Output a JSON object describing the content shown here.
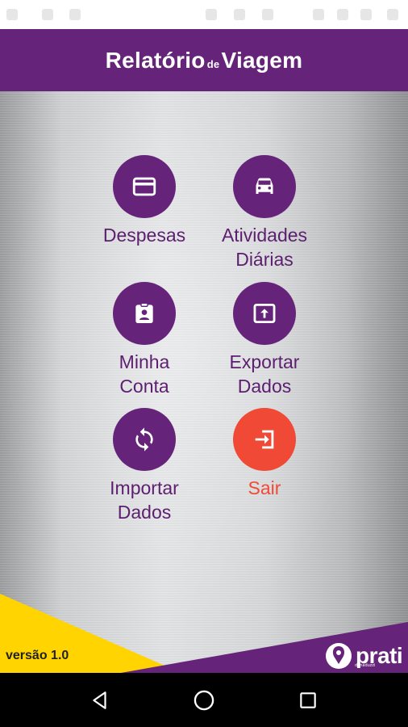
{
  "app": {
    "title_left": "Relatório",
    "title_connector": "de",
    "title_right": "Viagem"
  },
  "menu": {
    "despesas": {
      "label": "Despesas",
      "icon": "credit-card-icon"
    },
    "atividades": {
      "label": "Atividades\nDiárias",
      "icon": "car-icon"
    },
    "minha_conta": {
      "label": "Minha\nConta",
      "icon": "id-badge-icon"
    },
    "exportar": {
      "label": "Exportar\nDados",
      "icon": "upload-icon"
    },
    "importar": {
      "label": "Importar\nDados",
      "icon": "sync-icon"
    },
    "sair": {
      "label": "Sair",
      "icon": "exit-icon"
    }
  },
  "footer": {
    "version": "versão 1.0",
    "logo_text": "prati",
    "logo_subtext": "donaduzzi"
  },
  "colors": {
    "primary": "#65247a",
    "exit": "#f04a37",
    "accent_yellow": "#ffd400"
  },
  "navigation": {
    "back": "back-icon",
    "home": "home-icon",
    "recents": "recents-icon"
  }
}
